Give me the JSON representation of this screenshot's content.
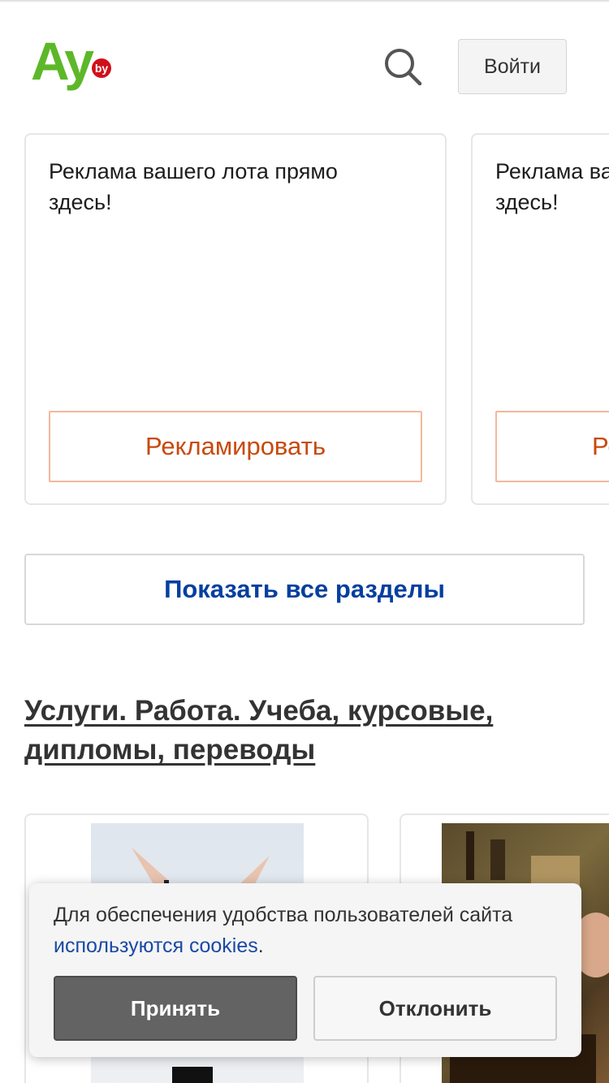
{
  "header": {
    "logo_text": "Ay",
    "logo_badge": "by",
    "search_icon": "search-icon",
    "login_label": "Войти"
  },
  "ads": [
    {
      "text": "Реклама вашего лота прямо здесь!",
      "button_label": "Рекламировать"
    },
    {
      "text": "Реклама вашего лота прямо здесь!",
      "button_label": "Рекламировать"
    }
  ],
  "show_all_label": "Показать все разделы",
  "section": {
    "title": "Услуги. Работа. Учеба, курсовые, дипломы, переводы"
  },
  "cookie": {
    "text": "Для обеспечения удобства пользователей сайта",
    "link_text": "используются cookies",
    "suffix": ".",
    "accept_label": "Принять",
    "decline_label": "Отклонить"
  },
  "colors": {
    "logo_green": "#5db829",
    "logo_badge_red": "#d0101b",
    "ad_button_text": "#c8490c",
    "ad_button_border": "#f3b79c",
    "link_blue": "#053f9f",
    "accept_bg": "#636363"
  }
}
